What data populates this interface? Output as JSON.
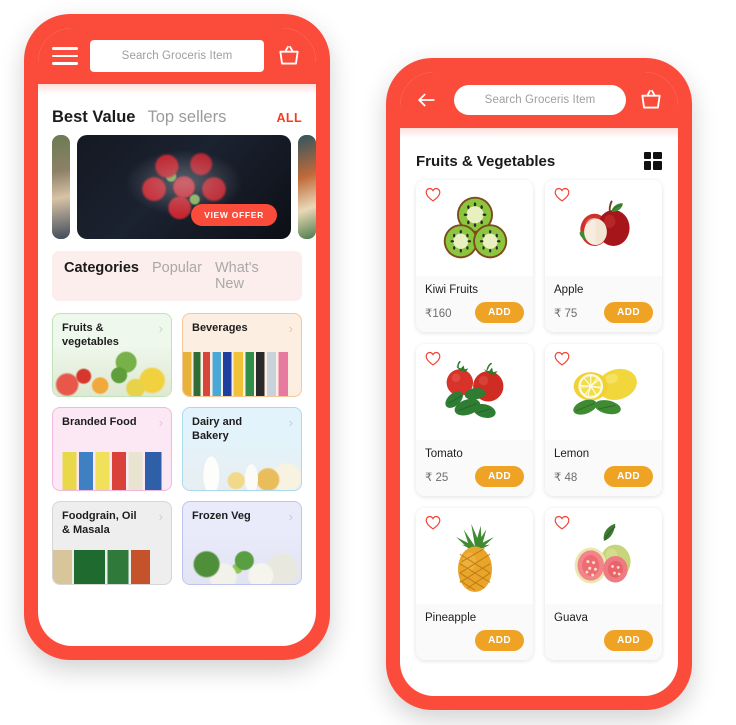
{
  "theme": {
    "brand_red": "#fb4c3b",
    "add_button_amber": "#efa324",
    "all_link_red": "#f73c1e"
  },
  "left_phone": {
    "appbar": {
      "menu_icon": "hamburger-icon",
      "cart_icon": "shopping-basket-icon",
      "search_placeholder": "Search Groceris Item"
    },
    "best_value": {
      "active_label": "Best Value",
      "inactive_label": "Top sellers",
      "all_label": "ALL"
    },
    "banner": {
      "cta_label": "VIEW OFFER"
    },
    "tabs": [
      {
        "label": "Categories",
        "active": true
      },
      {
        "label": "Popular",
        "active": false
      },
      {
        "label": "What's New",
        "active": false
      }
    ],
    "categories": [
      {
        "label": "Fruits & vegetables",
        "bg": "#eef8ec",
        "border": "#bfe3b8",
        "chevron": "#8fc98a"
      },
      {
        "label": "Beverages",
        "bg": "#fdeee2",
        "border": "#f3c79a",
        "chevron": "#ef9a4e"
      },
      {
        "label": "Branded Food",
        "bg": "#fbe8f4",
        "border": "#eeb9dd",
        "chevron": "#e79cd0"
      },
      {
        "label": "Dairy and Bakery",
        "bg": "#e3f3fb",
        "border": "#abd9ee",
        "chevron": "#84c6e6"
      },
      {
        "label": "Foodgrain, Oil & Masala",
        "bg": "#eeeeee",
        "border": "#d6d6d6",
        "chevron": "#b5b5b5"
      },
      {
        "label": "Frozen Veg",
        "bg": "#e9eafa",
        "border": "#c0c3f0",
        "chevron": "#a4a8ea"
      }
    ]
  },
  "right_phone": {
    "appbar": {
      "back_icon": "back-arrow-icon",
      "cart_icon": "shopping-basket-icon",
      "search_placeholder": "Search Groceris Item"
    },
    "page_title": "Fruits & Vegetables",
    "grid_toggle_icon": "grid-view-icon",
    "add_label": "ADD",
    "products": [
      {
        "name": "Kiwi Fruits",
        "price": "₹160",
        "favorite_icon": "heart-outline-icon"
      },
      {
        "name": "Apple",
        "price": "₹ 75",
        "favorite_icon": "heart-outline-icon"
      },
      {
        "name": "Tomato",
        "price": "₹ 25",
        "favorite_icon": "heart-outline-icon"
      },
      {
        "name": "Lemon",
        "price": "₹ 48",
        "favorite_icon": "heart-outline-icon"
      },
      {
        "name": "Pineapple",
        "price": "",
        "favorite_icon": "heart-outline-icon"
      },
      {
        "name": "Guava",
        "price": "",
        "favorite_icon": "heart-outline-icon"
      }
    ]
  }
}
